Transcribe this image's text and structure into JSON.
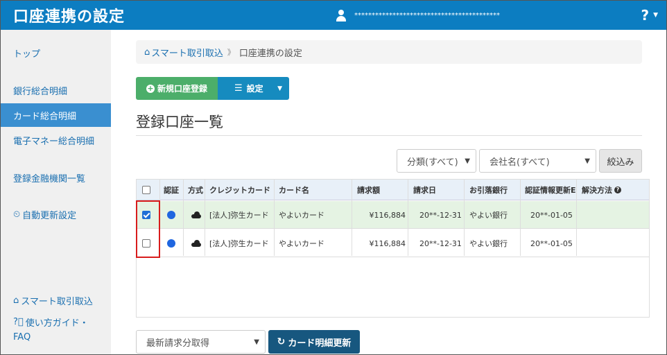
{
  "header": {
    "title": "口座連携の設定",
    "user_name": "******************************************",
    "help_icon": "?",
    "help_caret": "▼"
  },
  "sidebar": {
    "items": [
      {
        "label": "トップ"
      },
      {
        "label": "銀行総合明細"
      },
      {
        "label": "カード総合明細"
      },
      {
        "label": "電子マネー総合明細"
      },
      {
        "label": "登録金融機関一覧"
      },
      {
        "label": "自動更新設定"
      },
      {
        "label": "スマート取引取込"
      },
      {
        "label": "使い方ガイド・"
      },
      {
        "label": "FAQ"
      }
    ],
    "active_index": 2
  },
  "breadcrumb": {
    "home_label": "スマート取引取込",
    "separator": "》",
    "current": "口座連携の設定"
  },
  "toolbar": {
    "new_label": "新規口座登録",
    "settings_label": "設定"
  },
  "section": {
    "title": "登録口座一覧"
  },
  "filters": {
    "category": "分類(すべて)",
    "company": "会社名(すべて)",
    "filter_button": "絞込み"
  },
  "table": {
    "headers": [
      "認証",
      "方式",
      "クレジットカード",
      "カード名",
      "請求額",
      "請求日",
      "お引落銀行",
      "認証情報更新E",
      "解決方法"
    ],
    "rows": [
      {
        "checked": true,
        "credit_card": "[法人]弥生カード",
        "card_name": "やよいカード",
        "amount": "¥116,884",
        "billing_date": "20**-12-31",
        "bank": "やよい銀行",
        "auth_update": "20**-01-05",
        "resolution": ""
      },
      {
        "checked": false,
        "credit_card": "[法人]弥生カード",
        "card_name": "やよいカード",
        "amount": "¥116,884",
        "billing_date": "20**-12-31",
        "bank": "やよい銀行",
        "auth_update": "20**-01-05",
        "resolution": ""
      }
    ]
  },
  "bottom": {
    "select_value": "最新請求分取得",
    "update_button": "カード明細更新"
  },
  "colors": {
    "header_bg": "#0c7dc1",
    "active_sidebar": "#3a8fd0",
    "new_button": "#4cae6a",
    "settings_button": "#168bbf",
    "update_button": "#17577f",
    "highlight": "#d81c1c"
  }
}
